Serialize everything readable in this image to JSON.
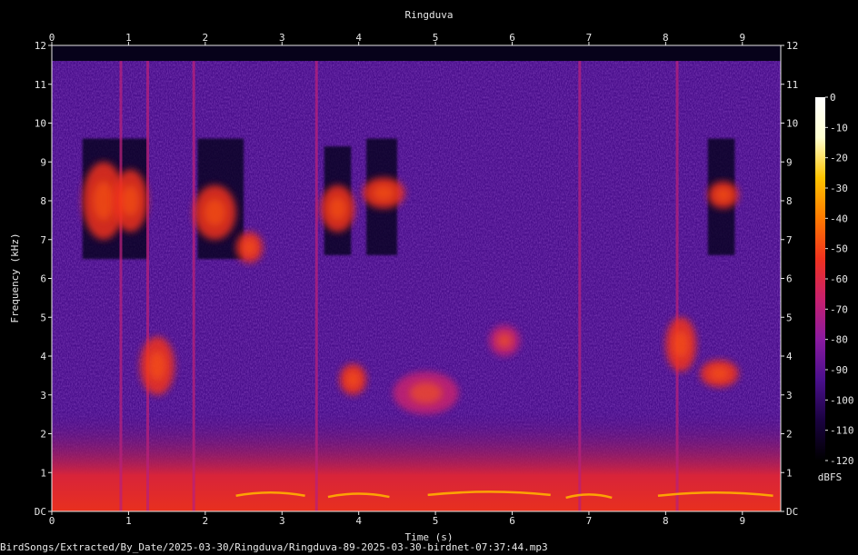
{
  "chart_data": {
    "type": "heatmap",
    "title": "Ringduva",
    "xlabel": "Time (s)",
    "ylabel": "Frequency (kHz)",
    "xlim": [
      0,
      9.5
    ],
    "ylim": [
      0,
      12
    ],
    "x_ticks": [
      0,
      1,
      2,
      3,
      4,
      5,
      6,
      7,
      8,
      9
    ],
    "y_ticks": [
      "DC",
      "1",
      "2",
      "3",
      "4",
      "5",
      "6",
      "7",
      "8",
      "9",
      "10",
      "11",
      "12"
    ],
    "colorbar": {
      "label": "dBFS",
      "ticks": [
        "0",
        "-10",
        "-20",
        "-30",
        "-40",
        "-50",
        "-60",
        "-70",
        "-80",
        "-90",
        "-100",
        "-110",
        "-120"
      ],
      "range": [
        -120,
        0
      ],
      "colormap": [
        "#000000",
        "#1a0240",
        "#4a0f8c",
        "#8a1aa0",
        "#c8206e",
        "#f0321e",
        "#ff7a00",
        "#ffc400",
        "#ffffd0",
        "#ffffff"
      ]
    },
    "background_level_dbfs": -95,
    "bandlimit_khz": 11.6,
    "events": [
      {
        "t0": 0.4,
        "t1": 0.95,
        "f0": 7.0,
        "f1": 9.0,
        "level": -55
      },
      {
        "t0": 0.8,
        "t1": 1.25,
        "f0": 7.2,
        "f1": 8.8,
        "level": -55
      },
      {
        "t0": 1.15,
        "t1": 1.6,
        "f0": 3.0,
        "f1": 4.5,
        "level": -55
      },
      {
        "t0": 1.85,
        "t1": 2.4,
        "f0": 7.0,
        "f1": 8.4,
        "level": -60
      },
      {
        "t0": 2.4,
        "t1": 2.75,
        "f0": 6.4,
        "f1": 7.2,
        "level": -55
      },
      {
        "t0": 3.5,
        "t1": 3.95,
        "f0": 7.2,
        "f1": 8.4,
        "level": -55
      },
      {
        "t0": 4.05,
        "t1": 4.6,
        "f0": 7.8,
        "f1": 8.6,
        "level": -50
      },
      {
        "t0": 3.75,
        "t1": 4.1,
        "f0": 3.0,
        "f1": 3.8,
        "level": -55
      },
      {
        "t0": 4.45,
        "t1": 5.3,
        "f0": 2.5,
        "f1": 3.6,
        "level": -65
      },
      {
        "t0": 5.7,
        "t1": 6.1,
        "f0": 4.0,
        "f1": 4.8,
        "level": -65
      },
      {
        "t0": 8.0,
        "t1": 8.4,
        "f0": 3.6,
        "f1": 5.0,
        "level": -55
      },
      {
        "t0": 8.45,
        "t1": 8.95,
        "f0": 3.2,
        "f1": 3.9,
        "level": -55
      },
      {
        "t0": 8.55,
        "t1": 8.95,
        "f0": 7.8,
        "f1": 8.5,
        "level": -55
      }
    ],
    "broadband_clicks_s": [
      0.9,
      1.25,
      1.85,
      3.45,
      6.88,
      8.15
    ],
    "low_band": {
      "f0": 0,
      "f1": 1.1,
      "level": -45
    },
    "tonal_traces": [
      {
        "t0": 2.4,
        "t1": 3.3,
        "f": 0.45
      },
      {
        "t0": 3.6,
        "t1": 4.4,
        "f": 0.42
      },
      {
        "t0": 4.9,
        "t1": 6.5,
        "f": 0.47
      },
      {
        "t0": 6.7,
        "t1": 7.3,
        "f": 0.4
      },
      {
        "t0": 7.9,
        "t1": 9.4,
        "f": 0.45
      }
    ],
    "dark_notches": [
      {
        "t0": 0.4,
        "t1": 1.25,
        "f0": 6.5,
        "f1": 9.6
      },
      {
        "t0": 1.9,
        "t1": 2.5,
        "f0": 6.5,
        "f1": 9.6
      },
      {
        "t0": 3.55,
        "t1": 3.9,
        "f0": 6.6,
        "f1": 9.4
      },
      {
        "t0": 4.1,
        "t1": 4.5,
        "f0": 6.6,
        "f1": 9.6
      },
      {
        "t0": 8.55,
        "t1": 8.9,
        "f0": 6.6,
        "f1": 9.6
      }
    ]
  },
  "footer": {
    "file_path": "BirdSongs/Extracted/By_Date/2025-03-30/Ringduva/Ringduva-89-2025-03-30-birdnet-07:37:44.mp3"
  }
}
